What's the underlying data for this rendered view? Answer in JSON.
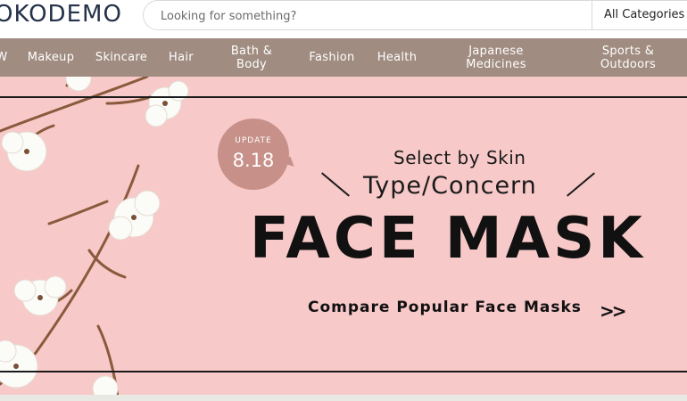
{
  "header": {
    "logo_text": "OKODEMO",
    "search": {
      "placeholder": "Looking for something?",
      "value": ""
    },
    "category_select": "All Categories"
  },
  "nav": {
    "items": [
      {
        "label": "W"
      },
      {
        "label": "Makeup"
      },
      {
        "label": "Skincare"
      },
      {
        "label": "Hair"
      },
      {
        "label": "Bath & Body"
      },
      {
        "label": "Fashion"
      },
      {
        "label": "Health"
      },
      {
        "label": "Japanese Medicines"
      },
      {
        "label": "Sports & Outdoors"
      }
    ]
  },
  "banner": {
    "update_label": "UPDATE",
    "update_date": "8.18",
    "subtitle_line1": "Select by Skin",
    "subtitle_line2": "Type/Concern",
    "headline": "FACE MASK",
    "cta": "Compare Popular Face Masks",
    "cta_arrow": ">>"
  },
  "colors": {
    "nav_bg": "#a08c80",
    "banner_bg": "#f8c9c9",
    "bubble": "#c79088",
    "logo": "#25324b"
  }
}
